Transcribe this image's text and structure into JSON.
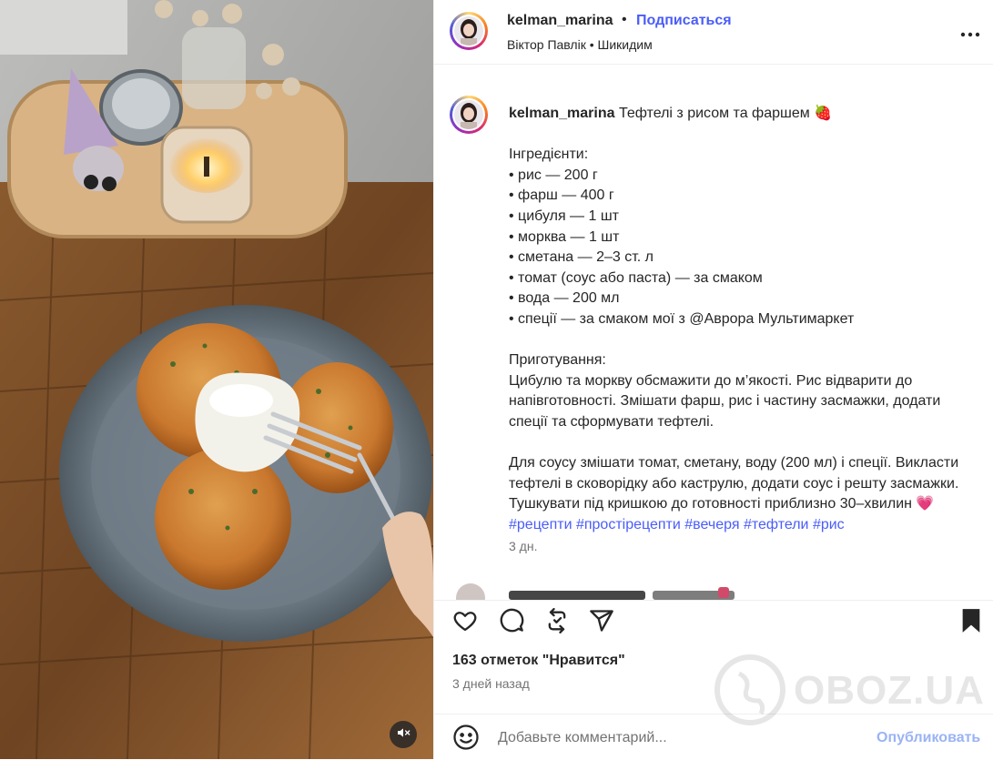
{
  "post": {
    "username": "kelman_marina",
    "follow_label": "Подписаться",
    "separator": "•",
    "audio_line": "Віктор Павлік • Шикидим"
  },
  "caption": {
    "username": "kelman_marina",
    "title": "Тефтелі з рисом та фаршем",
    "title_emoji": "🍓",
    "ingredients_header": "Інгредієнти:",
    "ingredients": [
      "• рис — 200 г",
      "• фарш — 400 г",
      "• цибуля — 1 шт",
      "• морква — 1 шт",
      "• сметана — 2–3 ст. л",
      "• томат (соус або паста) — за смаком",
      "• вода — 200 мл",
      "• спеції — за смаком мої з @Аврора Мультимаркет"
    ],
    "method_header": "Приготування:",
    "method_1": "Цибулю та моркву обсмажити до м’якості. Рис відварити до напівготовності. Змішати фарш, рис і частину засмажки, додати спеції та сформувати тефтелі.",
    "method_2": "Для соусу змішати томат, сметану, воду (200 мл) і спеції. Викласти тефтелі в сковорідку або каструлю, додати соус і решту засмажки. Тушкувати під кришкою до готовності приблизно 30–хвилин",
    "heart_emoji": "💗",
    "hashtags": [
      "#рецепти",
      "#простірецепти",
      "#вечеря",
      "#тефтели",
      "#рис"
    ],
    "age": "3 дн."
  },
  "actions": {
    "icons": [
      "heart-icon",
      "comment-icon",
      "repost-icon",
      "share-icon",
      "bookmark-icon"
    ]
  },
  "likes": "163 отметок \"Нравится\"",
  "posted": "3 дней назад",
  "comment_box": {
    "placeholder": "Добавьте комментарий...",
    "publish_label": "Опубликовать"
  },
  "watermark": "OBOZ.UA",
  "colors": {
    "link": "#4a5df9",
    "publish_disabled": "#9ab3f5",
    "muted_text": "#737373",
    "text": "#262626"
  }
}
